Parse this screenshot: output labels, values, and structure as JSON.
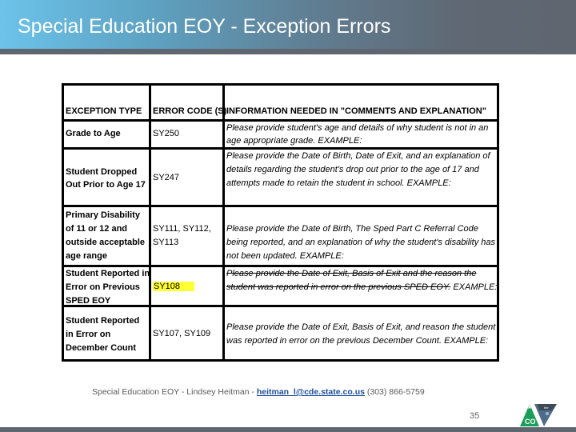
{
  "slide": {
    "title": "Special Education EOY - Exception Errors",
    "page_number": "35"
  },
  "table": {
    "headers": {
      "exception_type": "EXCEPTION TYPE",
      "error_codes": "ERROR CODE (S)",
      "info_needed": "INFORMATION NEEDED IN \"COMMENTS AND EXPLANATION\""
    },
    "rows": [
      {
        "exception_type": "Grade to Age",
        "error_codes": "SY250",
        "info_needed": "Please provide student's age and details of why student is not in an age appropriate grade.  EXAMPLE:"
      },
      {
        "exception_type": "Student Dropped Out Prior to Age 17",
        "error_codes": "SY247",
        "info_needed": "Please provide the Date of Birth, Date of Exit, and an explanation of details regarding the student's drop out prior to the age of 17 and attempts made to retain the student in school.  EXAMPLE:"
      },
      {
        "exception_type": "Primary Disability of 11 or 12 and outside acceptable age range",
        "error_codes": "SY111, SY112, SY113",
        "info_needed": "Please provide the Date of Birth, The Sped Part C Referral Code being reported, and an explanation of why the student's disability has not been updated.  EXAMPLE:"
      },
      {
        "exception_type": "Student Reported in Error on Previous SPED EOY",
        "error_codes": "SY108",
        "info_needed_struck": "Please provide the Date of Exit, Basis of Exit and the reason the student was reported in error on the previous SPED EOY.",
        "info_needed": "EXAMPLE:"
      },
      {
        "exception_type": "Student Reported in Error on December Count",
        "error_codes": "SY107, SY109",
        "info_needed": "Please provide the Date of Exit, Basis of Exit, and reason the student was reported in error on the previous December Count. EXAMPLE:"
      }
    ]
  },
  "footer": {
    "prefix": "Special Education EOY - Lindsey Heitman - ",
    "email": "heitman_l@cde.state.co.us",
    "phone": " (303) 866-5759"
  },
  "logo": {
    "icon": "colorado-cde-logo-icon",
    "text": "CO",
    "colors": {
      "green": "#1a9e5a",
      "blue_gray": "#4f6d8a",
      "dark": "#3d4a56"
    }
  },
  "colors": {
    "highlight": "#ffff33",
    "title_gradient_start": "#6cc3ea",
    "title_gradient_end": "#5f6670"
  }
}
